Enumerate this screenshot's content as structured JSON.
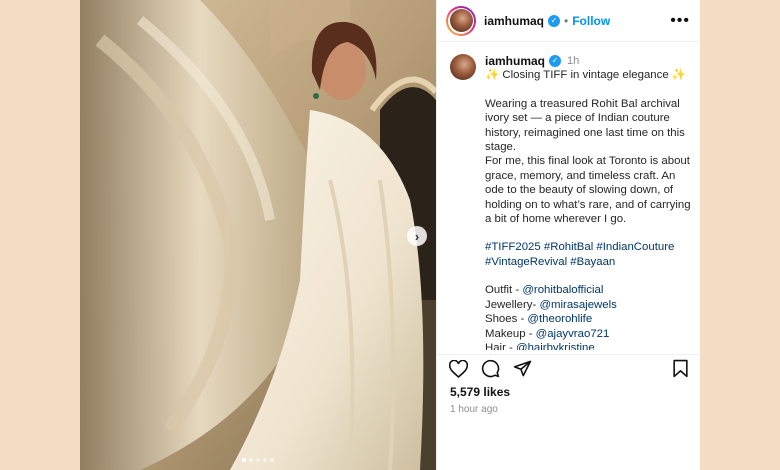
{
  "post": {
    "username": "iamhumaq",
    "follow_label": "Follow",
    "separator": "•",
    "more_label": "•••",
    "verified_mark": "✓",
    "caption": {
      "time": "1h",
      "headline_spark": "✨",
      "headline": "Closing TIFF in vintage elegance",
      "paragraph1": "Wearing a treasured Rohit Bal archival ivory set — a piece of Indian couture history, reimagined one last time on this stage.",
      "paragraph2": "For me, this final look at Toronto is about grace, memory, and timeless craft. An ode to the beauty of slowing down, of holding on to what’s rare, and of carrying a bit of home wherever I go.",
      "hashtags_line1": "#TIFF2025 #RohitBal #IndianCouture",
      "hashtags_line2": "#VintageRevival #Bayaan",
      "credits": [
        {
          "label": "Outfit - ",
          "mention": "@rohitbalofficial"
        },
        {
          "label": "Jewellery- ",
          "mention": "@mirasajewels"
        },
        {
          "label": "Shoes - ",
          "mention": "@theorohlife"
        },
        {
          "label": "Makeup - ",
          "mention": "@ajayvrao721"
        },
        {
          "label": "Hair - ",
          "mention": "@hairbykristine"
        }
      ]
    },
    "likes": "5,579 likes",
    "time_ago": "1 hour ago",
    "next_label": "›",
    "carousel": {
      "total": 5,
      "active_index": 0
    },
    "icons": {
      "like": "heart-icon",
      "comment": "comment-icon",
      "share": "share-icon",
      "save": "bookmark-icon"
    }
  }
}
